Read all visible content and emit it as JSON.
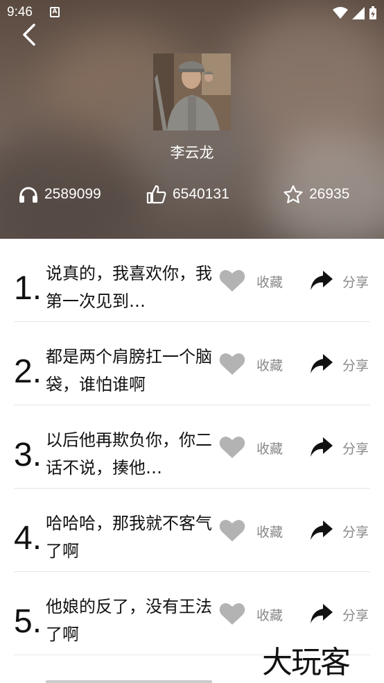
{
  "status_bar": {
    "time": "9:46",
    "notification_badge": "A"
  },
  "profile": {
    "name": "李云龙",
    "stats": [
      {
        "icon": "headphones-icon",
        "value": "2589099"
      },
      {
        "icon": "thumbs-up-icon",
        "value": "6540131"
      },
      {
        "icon": "star-icon",
        "value": "26935"
      }
    ]
  },
  "quotes": [
    {
      "number": "1.",
      "text": "说真的，我喜欢你，我第一次见到…",
      "fav_label": "收藏",
      "share_label": "分享"
    },
    {
      "number": "2.",
      "text": "都是两个肩膀扛一个脑袋，谁怕谁啊",
      "fav_label": "收藏",
      "share_label": "分享"
    },
    {
      "number": "3.",
      "text": "以后他再欺负你，你二话不说，揍他…",
      "fav_label": "收藏",
      "share_label": "分享"
    },
    {
      "number": "4.",
      "text": "哈哈哈，那我就不客气了啊",
      "fav_label": "收藏",
      "share_label": "分享"
    },
    {
      "number": "5.",
      "text": "他娘的反了，没有王法了啊",
      "fav_label": "收藏",
      "share_label": "分享"
    }
  ],
  "watermark": "大玩客",
  "colors": {
    "icon_gray": "#b3b3b3",
    "label_gray": "#888888",
    "share_black": "#111111"
  }
}
